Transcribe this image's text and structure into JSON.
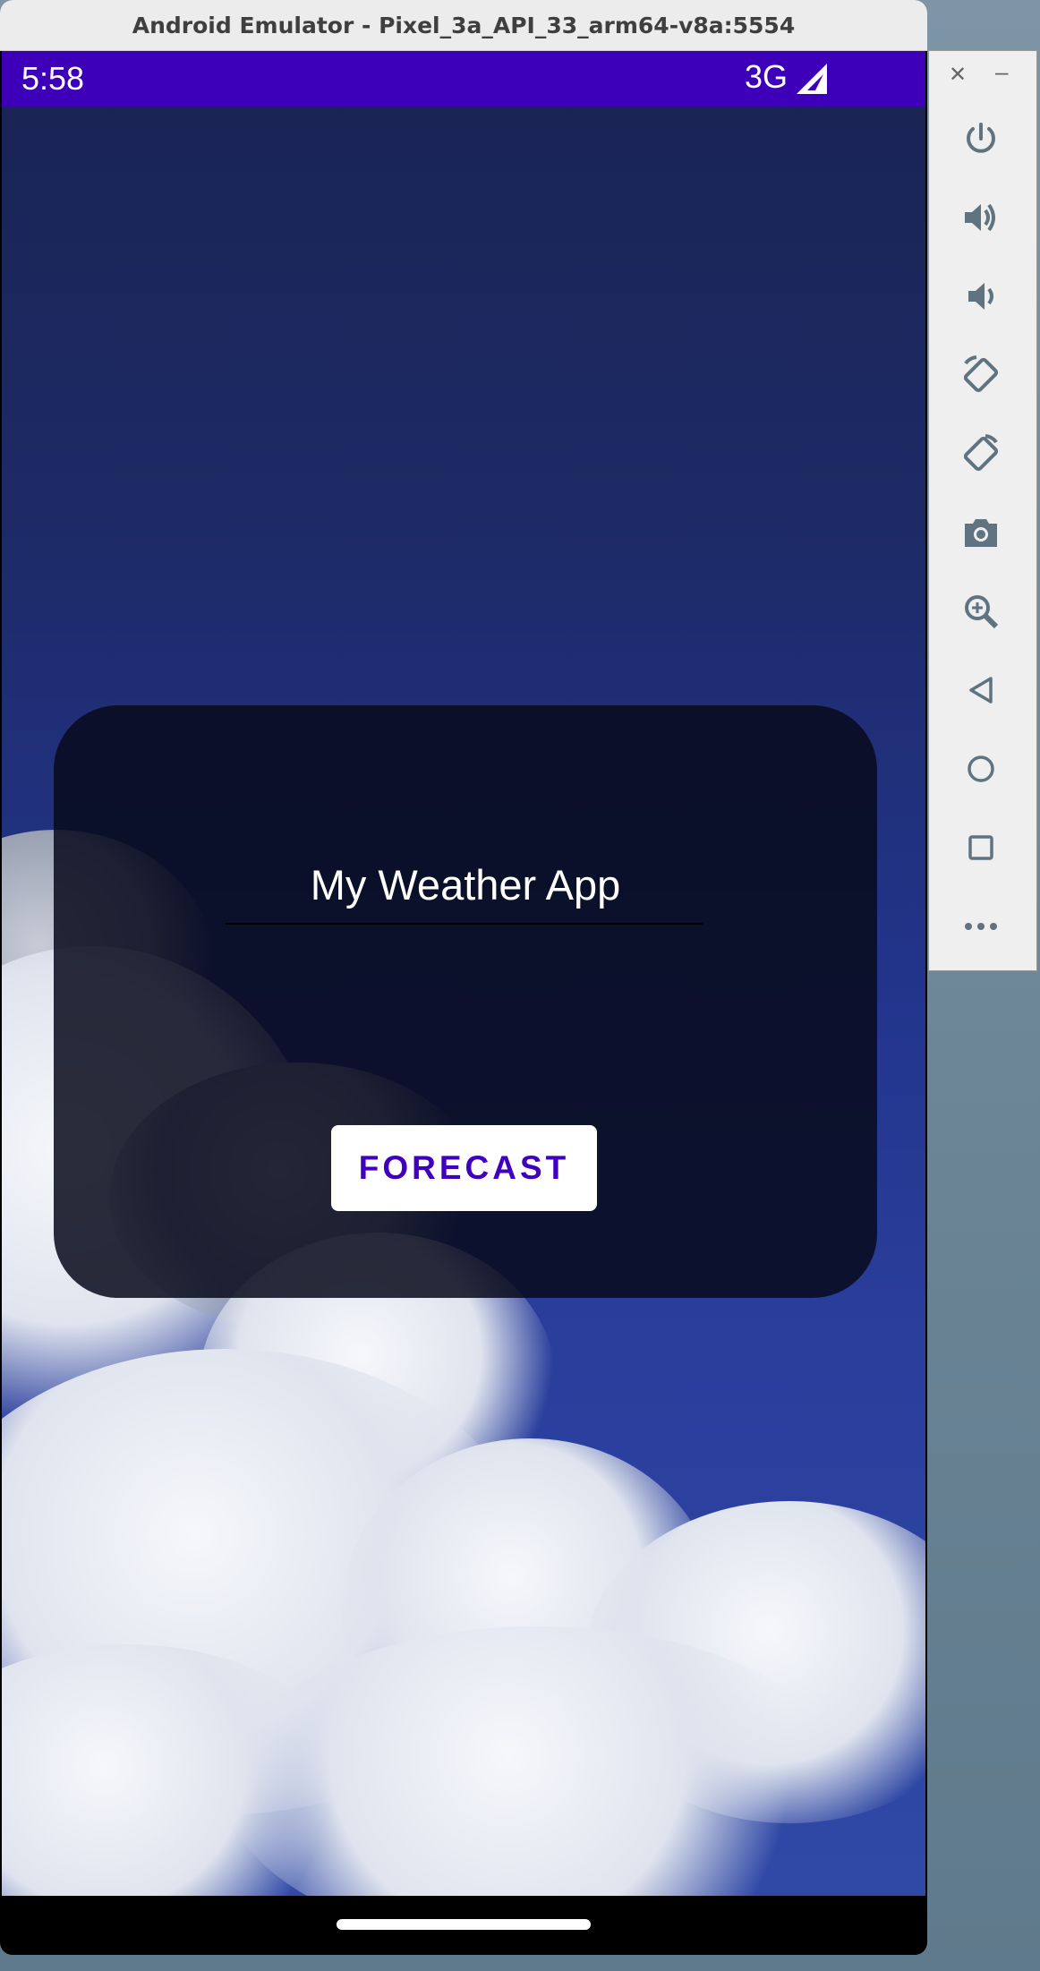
{
  "window": {
    "title": "Android Emulator - Pixel_3a_API_33_arm64-v8a:5554"
  },
  "status_bar": {
    "time": "5:58",
    "network": "3G",
    "icons": [
      "signal-icon"
    ]
  },
  "app": {
    "title": "My Weather App",
    "button_label": "FORECAST"
  },
  "toolbar": {
    "window_controls": [
      "close-icon",
      "minimize-icon"
    ],
    "items": [
      "power-icon",
      "volume-up-icon",
      "volume-down-icon",
      "rotate-left-icon",
      "rotate-right-icon",
      "camera-icon",
      "zoom-icon",
      "back-icon",
      "home-icon",
      "overview-icon",
      "more-icon"
    ]
  },
  "colors": {
    "status_bar": "#3d00b8",
    "button_text": "#3f00c0",
    "card": "#0a0c1c",
    "toolbar_icon": "#5f7380"
  }
}
